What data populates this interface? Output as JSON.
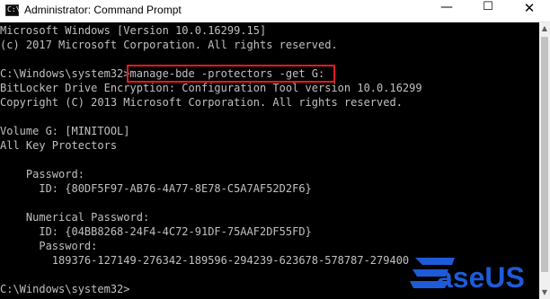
{
  "window": {
    "title": "Administrator: Command Prompt",
    "icon": "cmd-icon",
    "icon_text": "C:\\",
    "controls": {
      "minimize": "—",
      "maximize": "☐",
      "close": "✕"
    }
  },
  "console": {
    "lines": [
      "Microsoft Windows [Version 10.0.16299.15]",
      "(c) 2017 Microsoft Corporation. All rights reserved.",
      "",
      "C:\\Windows\\system32>manage-bde -protectors -get G:",
      "BitLocker Drive Encryption: Configuration Tool version 10.0.16299",
      "Copyright (C) 2013 Microsoft Corporation. All rights reserved.",
      "",
      "Volume G: [MINITOOL]",
      "All Key Protectors",
      "",
      "    Password:",
      "      ID: {80DF5F97-AB76-4A77-8E78-C5A7AF52D2F6}",
      "",
      "    Numerical Password:",
      "      ID: {04BB8268-24F4-4C72-91DF-75AAF2DF55FD}",
      "      Password:",
      "        189376-127149-276342-189596-294239-623678-578787-279400",
      "",
      "C:\\Windows\\system32>"
    ],
    "highlighted_command": "manage-bde -protectors -get G:",
    "text_color": "#c0c0c0",
    "background": "#000000",
    "highlight_color": "#e21a1a"
  },
  "watermark": {
    "text": "EaseUS",
    "color": "#1e5bd8"
  }
}
